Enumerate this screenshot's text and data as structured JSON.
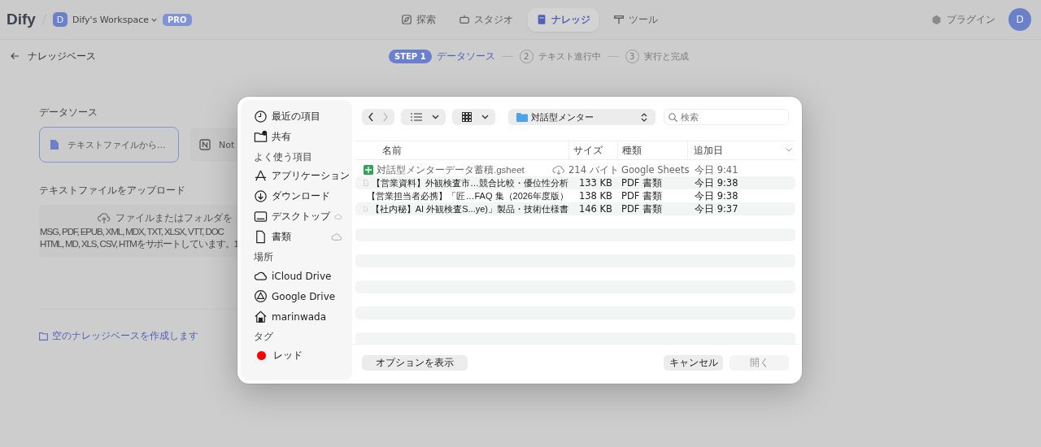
{
  "header": {
    "logo": "Dify",
    "workspace": {
      "avatar": "D",
      "name": "Dify's Workspace",
      "badge": "PRO"
    },
    "nav": [
      {
        "label": "探索",
        "selected": false
      },
      {
        "label": "スタジオ",
        "selected": false
      },
      {
        "label": "ナレッジ",
        "selected": true
      },
      {
        "label": "ツール",
        "selected": false
      }
    ],
    "plugins": "プラグイン",
    "avatar": "D"
  },
  "subheader": {
    "back": "ナレッジベース",
    "steps": [
      {
        "badge": "STEP 1",
        "label": "データソース",
        "selected": true
      },
      {
        "badge": "2",
        "label": "テキスト進行中",
        "selected": false
      },
      {
        "badge": "3",
        "label": "実行と完成",
        "selected": false
      }
    ]
  },
  "content": {
    "section_title": "データソース",
    "sources": [
      {
        "label": "テキストファイルから...",
        "selected": true
      },
      {
        "label": "Not",
        "selected": false
      }
    ],
    "upload_title": "テキストファイルをアップロード",
    "upload": {
      "prompt": "ファイルまたはフォルダを",
      "formats": [
        "MSG, PDF, EPUB, XML, MDX, TXT, XLSX, VTT, DOC",
        "HTML, MD, XLS, CSV, HTMをサポートしています。1"
      ]
    },
    "create_empty": "空のナレッジベースを作成します"
  },
  "dialog": {
    "sidebar": [
      {
        "items": [
          {
            "label": "最近の項目",
            "cloud": false
          },
          {
            "label": "共有",
            "cloud": false
          }
        ]
      },
      {
        "heading": "よく使う項目",
        "items": [
          {
            "label": "アプリケーション",
            "cloud": false
          },
          {
            "label": "ダウンロード",
            "cloud": false
          },
          {
            "label": "デスクトップ",
            "cloud": true
          },
          {
            "label": "書類",
            "cloud": true
          }
        ]
      },
      {
        "heading": "場所",
        "items": [
          {
            "label": "iCloud Drive",
            "cloud": false
          },
          {
            "label": "Google Drive",
            "cloud": false
          },
          {
            "label": "marinwada",
            "cloud": false
          }
        ]
      },
      {
        "heading": "タグ",
        "items": [
          {
            "label": "レッド",
            "color": "#ff0000"
          }
        ]
      }
    ],
    "folder": "対話型メンター",
    "search": {
      "placeholder": "検索"
    },
    "columns": [
      "名前",
      "サイズ",
      "種類",
      "追加日"
    ],
    "rows": [
      {
        "kind": "sheet",
        "name": "対話型メンターデータ蓄積.gsheet",
        "size": "214 バイト",
        "type": "Google Sheets",
        "date": "今日 9:41",
        "disabled": true,
        "cloud": true
      },
      {
        "kind": "pdf",
        "name": "【営業資料】外観検査市…競合比較・優位性分析",
        "size": "133 KB",
        "type": "PDF 書類",
        "date": "今日 9:38",
        "disabled": false,
        "cloud": false
      },
      {
        "kind": "pdf",
        "name": "【営業担当者必携】「匠…FAQ 集（2026年度版）",
        "size": "138 KB",
        "type": "PDF 書類",
        "date": "今日 9:38",
        "disabled": false,
        "cloud": false
      },
      {
        "kind": "pdf",
        "name": "【社内秘】AI 外観検査S...ye)」製品・技術仕様書",
        "size": "146 KB",
        "type": "PDF 書類",
        "date": "今日 9:37",
        "disabled": false,
        "cloud": false
      }
    ],
    "options_button": "オプションを表示",
    "buttons": [
      {
        "label": "キャンセル",
        "disabled": false
      },
      {
        "label": "開く",
        "disabled": true
      }
    ]
  }
}
